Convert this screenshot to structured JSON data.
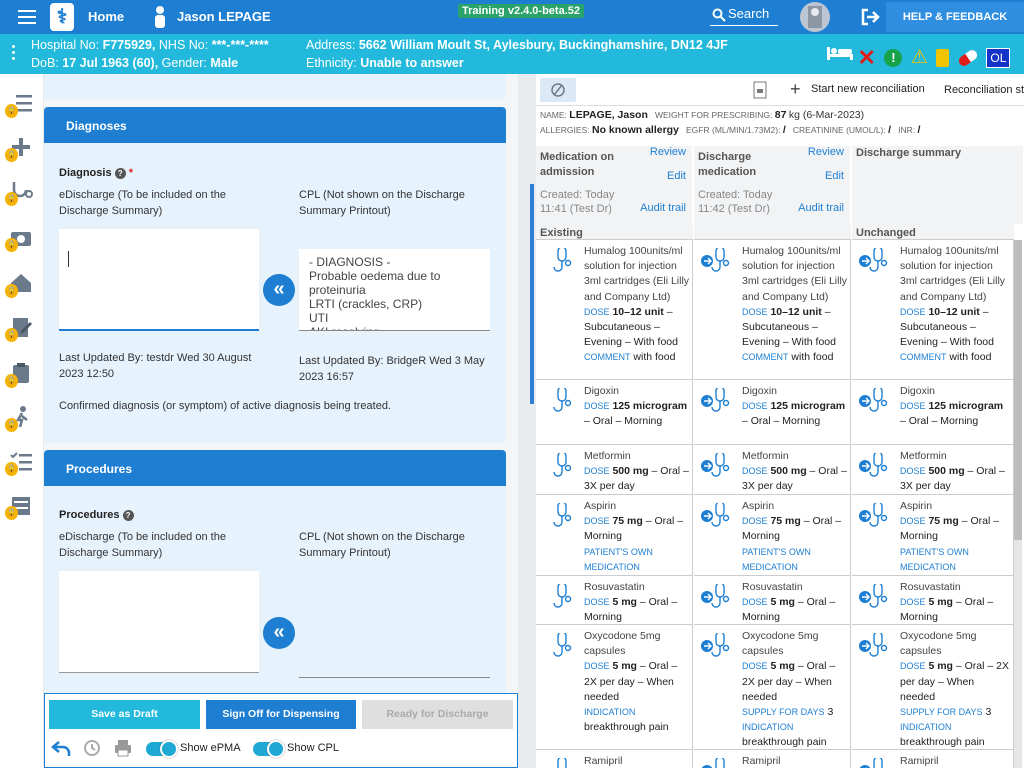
{
  "topbar": {
    "home": "Home",
    "user_name": "Jason LEPAGE",
    "version": "Training v2.4.0-beta.52",
    "search": "Search",
    "help": "HELP & FEEDBACK"
  },
  "patient": {
    "hospital_label": "Hospital No:",
    "hospital_no": "F775929,",
    "nhs_label": "NHS No:",
    "nhs_no": "***-***-****",
    "dob_label": "DoB:",
    "dob": "17 Jul 1963 (60),",
    "gender_label": "Gender:",
    "gender": "Male",
    "address_label": "Address:",
    "address": "5662 William Moult St, Aylesbury, Buckinghamshire, DN12 4JF",
    "ethnicity_label": "Ethnicity:",
    "ethnicity": "Unable to answer",
    "initials": "OL"
  },
  "diagnoses": {
    "header": "Diagnoses",
    "label": "Diagnosis",
    "required": "*",
    "edischarge": "eDischarge (To be included on the Discharge Summary)",
    "cpl": "CPL (Not shown on the Discharge Summary Printout)",
    "cpl_text": " - DIAGNOSIS -\nProbable oedema due to proteinuria\nLRTI (crackles, CRP)\nUTI\nAKI resolving",
    "updated_left": "Last Updated By: testdr Wed 30 August 2023 12:50",
    "updated_right": "Last Updated By: BridgeR Wed 3 May 2023 16:57",
    "note": "Confirmed diagnosis (or symptom) of active diagnosis being treated."
  },
  "procedures": {
    "header": "Procedures",
    "label": "Procedures",
    "edischarge": "eDischarge (To be included on the Discharge Summary)",
    "cpl": "CPL (Not shown on the Discharge Summary Printout)"
  },
  "actions": {
    "save": "Save as Draft",
    "signoff": "Sign Off for Dispensing",
    "ready": "Ready for Discharge",
    "show_epma": "Show ePMA",
    "show_cpl": "Show CPL"
  },
  "recon": {
    "start": "Start new reconciliation",
    "status": "Reconciliation st",
    "name_label": "NAME:",
    "name": "LEPAGE, Jason",
    "weight_label": "WEIGHT FOR PRESCRIBING:",
    "weight": "87",
    "weight_unit": "kg (6-Mar-2023)",
    "allergies_label": "ALLERGIES:",
    "allergies": "No known allergy",
    "egfr_label": "EGFR (ML/MIN/1.73M2):",
    "egfr": "/",
    "creat_label": "CREATININE (UMOL/L):",
    "creat": "/",
    "inr_label": "INR:",
    "inr": "/",
    "col1": {
      "title": "Medication on admission",
      "review": "Review",
      "edit": "Edit",
      "created": "Created: Today",
      "time": "11:41 (Test Dr)",
      "audit": "Audit trail"
    },
    "col2": {
      "title": "Discharge medication",
      "review": "Review",
      "edit": "Edit",
      "created": "Created: Today",
      "time": "11:42 (Test Dr)",
      "audit": "Audit trail"
    },
    "col3": {
      "title": "Discharge summary"
    },
    "sec1": "Existing",
    "sec3": "Unchanged"
  },
  "meds": [
    {
      "name": "Humalog 100units/ml solution for injection 3ml cartridges (Eli Lilly and Company Ltd)",
      "k1": "DOSE",
      "dose": "10–12 unit",
      "rest": "– Subcutaneous – Evening – With food",
      "k2": "COMMENT",
      "extra": "with food"
    },
    {
      "name": "Digoxin",
      "k1": "DOSE",
      "dose": "125 microgram",
      "rest": "– Oral – Morning",
      "k2": "",
      "extra": ""
    },
    {
      "name": "Metformin",
      "k1": "DOSE",
      "dose": "500 mg",
      "rest": "– Oral – 3X per day",
      "k2": "",
      "extra": ""
    },
    {
      "name": "Aspirin",
      "k1": "DOSE",
      "dose": "75 mg",
      "rest": "– Oral – Morning",
      "k2": "PATIENT'S OWN MEDICATION",
      "extra": ""
    },
    {
      "name": "Rosuvastatin",
      "k1": "DOSE",
      "dose": "5 mg",
      "rest": "– Oral – Morning",
      "k2": "",
      "extra": ""
    },
    {
      "name": "Oxycodone 5mg capsules",
      "k1": "DOSE",
      "dose": "5 mg",
      "rest": "– Oral – 2X per day – When needed",
      "k2": "INDICATION",
      "extra": "breakthrough pain",
      "supply_label": "SUPPLY FOR DAYS",
      "supply": "3"
    },
    {
      "name": "Ramipril",
      "k1": "",
      "dose": "",
      "rest": "",
      "k2": "",
      "extra": ""
    }
  ]
}
